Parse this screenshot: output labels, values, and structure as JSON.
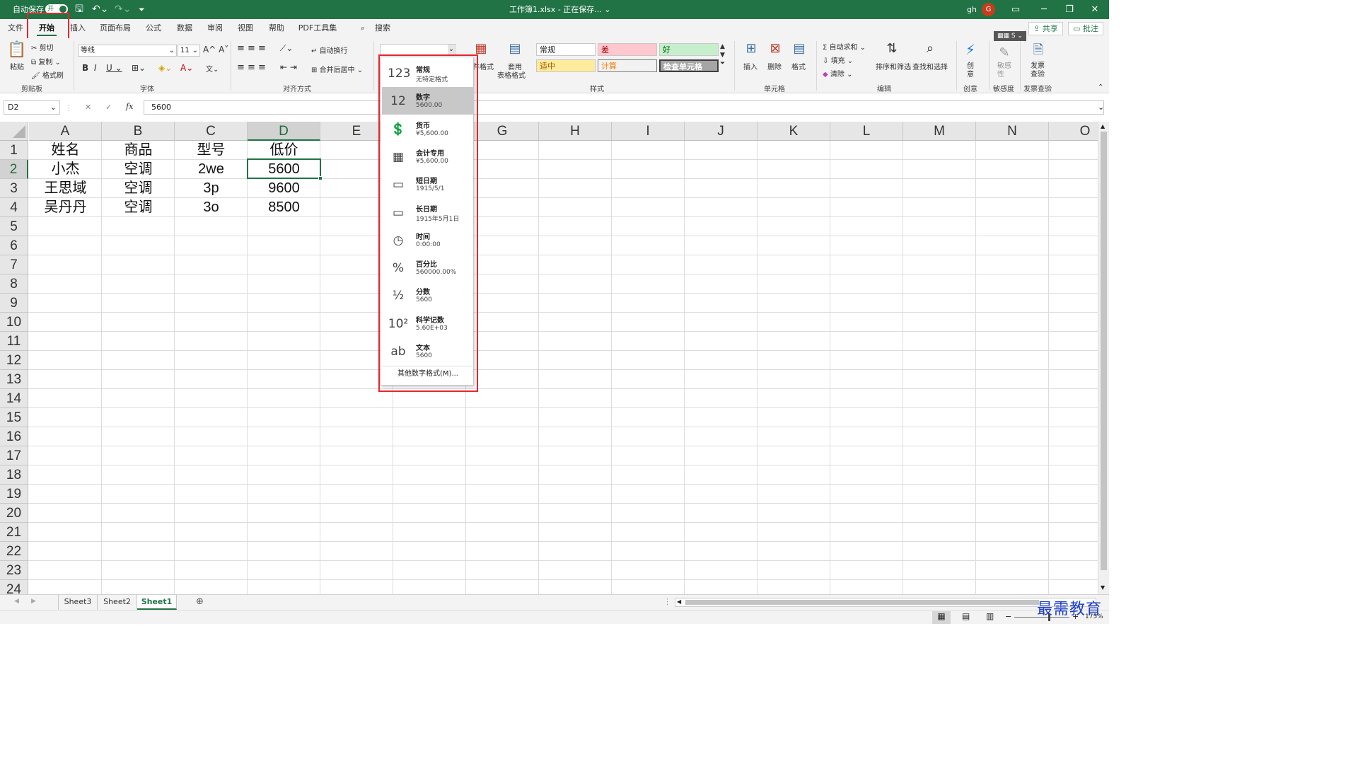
{
  "titlebar": {
    "autosave_label": "自动保存",
    "autosave_state": "开",
    "file_title": "工作簿1.xlsx - 正在保存... ⌄",
    "user_name": "gh",
    "user_initial": "G"
  },
  "tabs": [
    "文件",
    "开始",
    "插入",
    "页面布局",
    "公式",
    "数据",
    "审阅",
    "视图",
    "帮助",
    "PDF工具集"
  ],
  "search_label": "搜索",
  "share_label": "共享",
  "comment_label": "批注",
  "ribbon": {
    "paste": "粘贴",
    "cut": "剪切",
    "copy": "复制",
    "format_painter": "格式刷",
    "clipboard_group": "剪贴板",
    "font_name": "等线",
    "font_size": "11",
    "font_group": "字体",
    "wrap_text": "自动换行",
    "merge_center": "合并后居中",
    "align_group": "对齐方式",
    "cond_format": "件格式",
    "table_format_1": "套用",
    "table_format_2": "表格格式",
    "styles_group": "样式",
    "style_normal": "常规",
    "style_bad": "差",
    "style_good": "好",
    "style_neutral": "适中",
    "style_calc": "计算",
    "style_check": "检查单元格",
    "insert": "插入",
    "delete": "删除",
    "format": "格式",
    "cells_group": "单元格",
    "autosum": "自动求和",
    "fill": "填充",
    "clear": "清除",
    "sort_filter": "排序和筛选",
    "find_select": "查找和选择",
    "edit_group": "编辑",
    "create_1": "创",
    "create_2": "意",
    "creative_group": "创意",
    "sensitivity_1": "敏感",
    "sensitivity_2": "性",
    "sensitivity_group": "敏感度",
    "invoice_1": "发票",
    "invoice_2": "查验",
    "invoice_group": "发票查验"
  },
  "formula": {
    "name_box": "D2",
    "value": "5600"
  },
  "columns": [
    "A",
    "B",
    "C",
    "D",
    "E",
    "F",
    "G",
    "H",
    "I",
    "J",
    "K",
    "L",
    "M",
    "N",
    "O"
  ],
  "rows": [
    "1",
    "2",
    "3",
    "4",
    "5",
    "6",
    "7",
    "8",
    "9",
    "10",
    "11",
    "12",
    "13",
    "14",
    "15",
    "16",
    "17",
    "18",
    "19",
    "20",
    "21",
    "22",
    "23",
    "24"
  ],
  "cells": [
    [
      "姓名",
      "商品",
      "型号",
      "低价"
    ],
    [
      "小杰",
      "空调",
      "2we",
      "5600"
    ],
    [
      "王思域",
      "空调",
      "3p",
      "9600"
    ],
    [
      "吴丹丹",
      "空调",
      "3o",
      "8500"
    ]
  ],
  "number_formats": [
    {
      "icon": "123",
      "name": "常规",
      "value": "无特定格式"
    },
    {
      "icon": "12",
      "name": "数字",
      "value": "5600.00"
    },
    {
      "icon": "💲",
      "name": "货币",
      "value": "¥5,600.00"
    },
    {
      "icon": "▦",
      "name": "会计专用",
      "value": " ¥5,600.00"
    },
    {
      "icon": "▭",
      "name": "短日期",
      "value": "1915/5/1"
    },
    {
      "icon": "▭",
      "name": "长日期",
      "value": "1915年5月1日"
    },
    {
      "icon": "◷",
      "name": "时间",
      "value": "0:00:00"
    },
    {
      "icon": "%",
      "name": "百分比",
      "value": "560000.00%"
    },
    {
      "icon": "½",
      "name": "分数",
      "value": "5600"
    },
    {
      "icon": "10²",
      "name": "科学记数",
      "value": "5.60E+03"
    },
    {
      "icon": "ab",
      "name": "文本",
      "value": "5600"
    }
  ],
  "more_formats": "其他数字格式(M)...",
  "sheets": [
    "Sheet3",
    "Sheet2",
    "Sheet1"
  ],
  "active_sheet": "Sheet1",
  "zoom": "175%",
  "watermark": "最需教育",
  "colors": {
    "excel_green": "#217346",
    "highlight_red": "#e5262f"
  }
}
